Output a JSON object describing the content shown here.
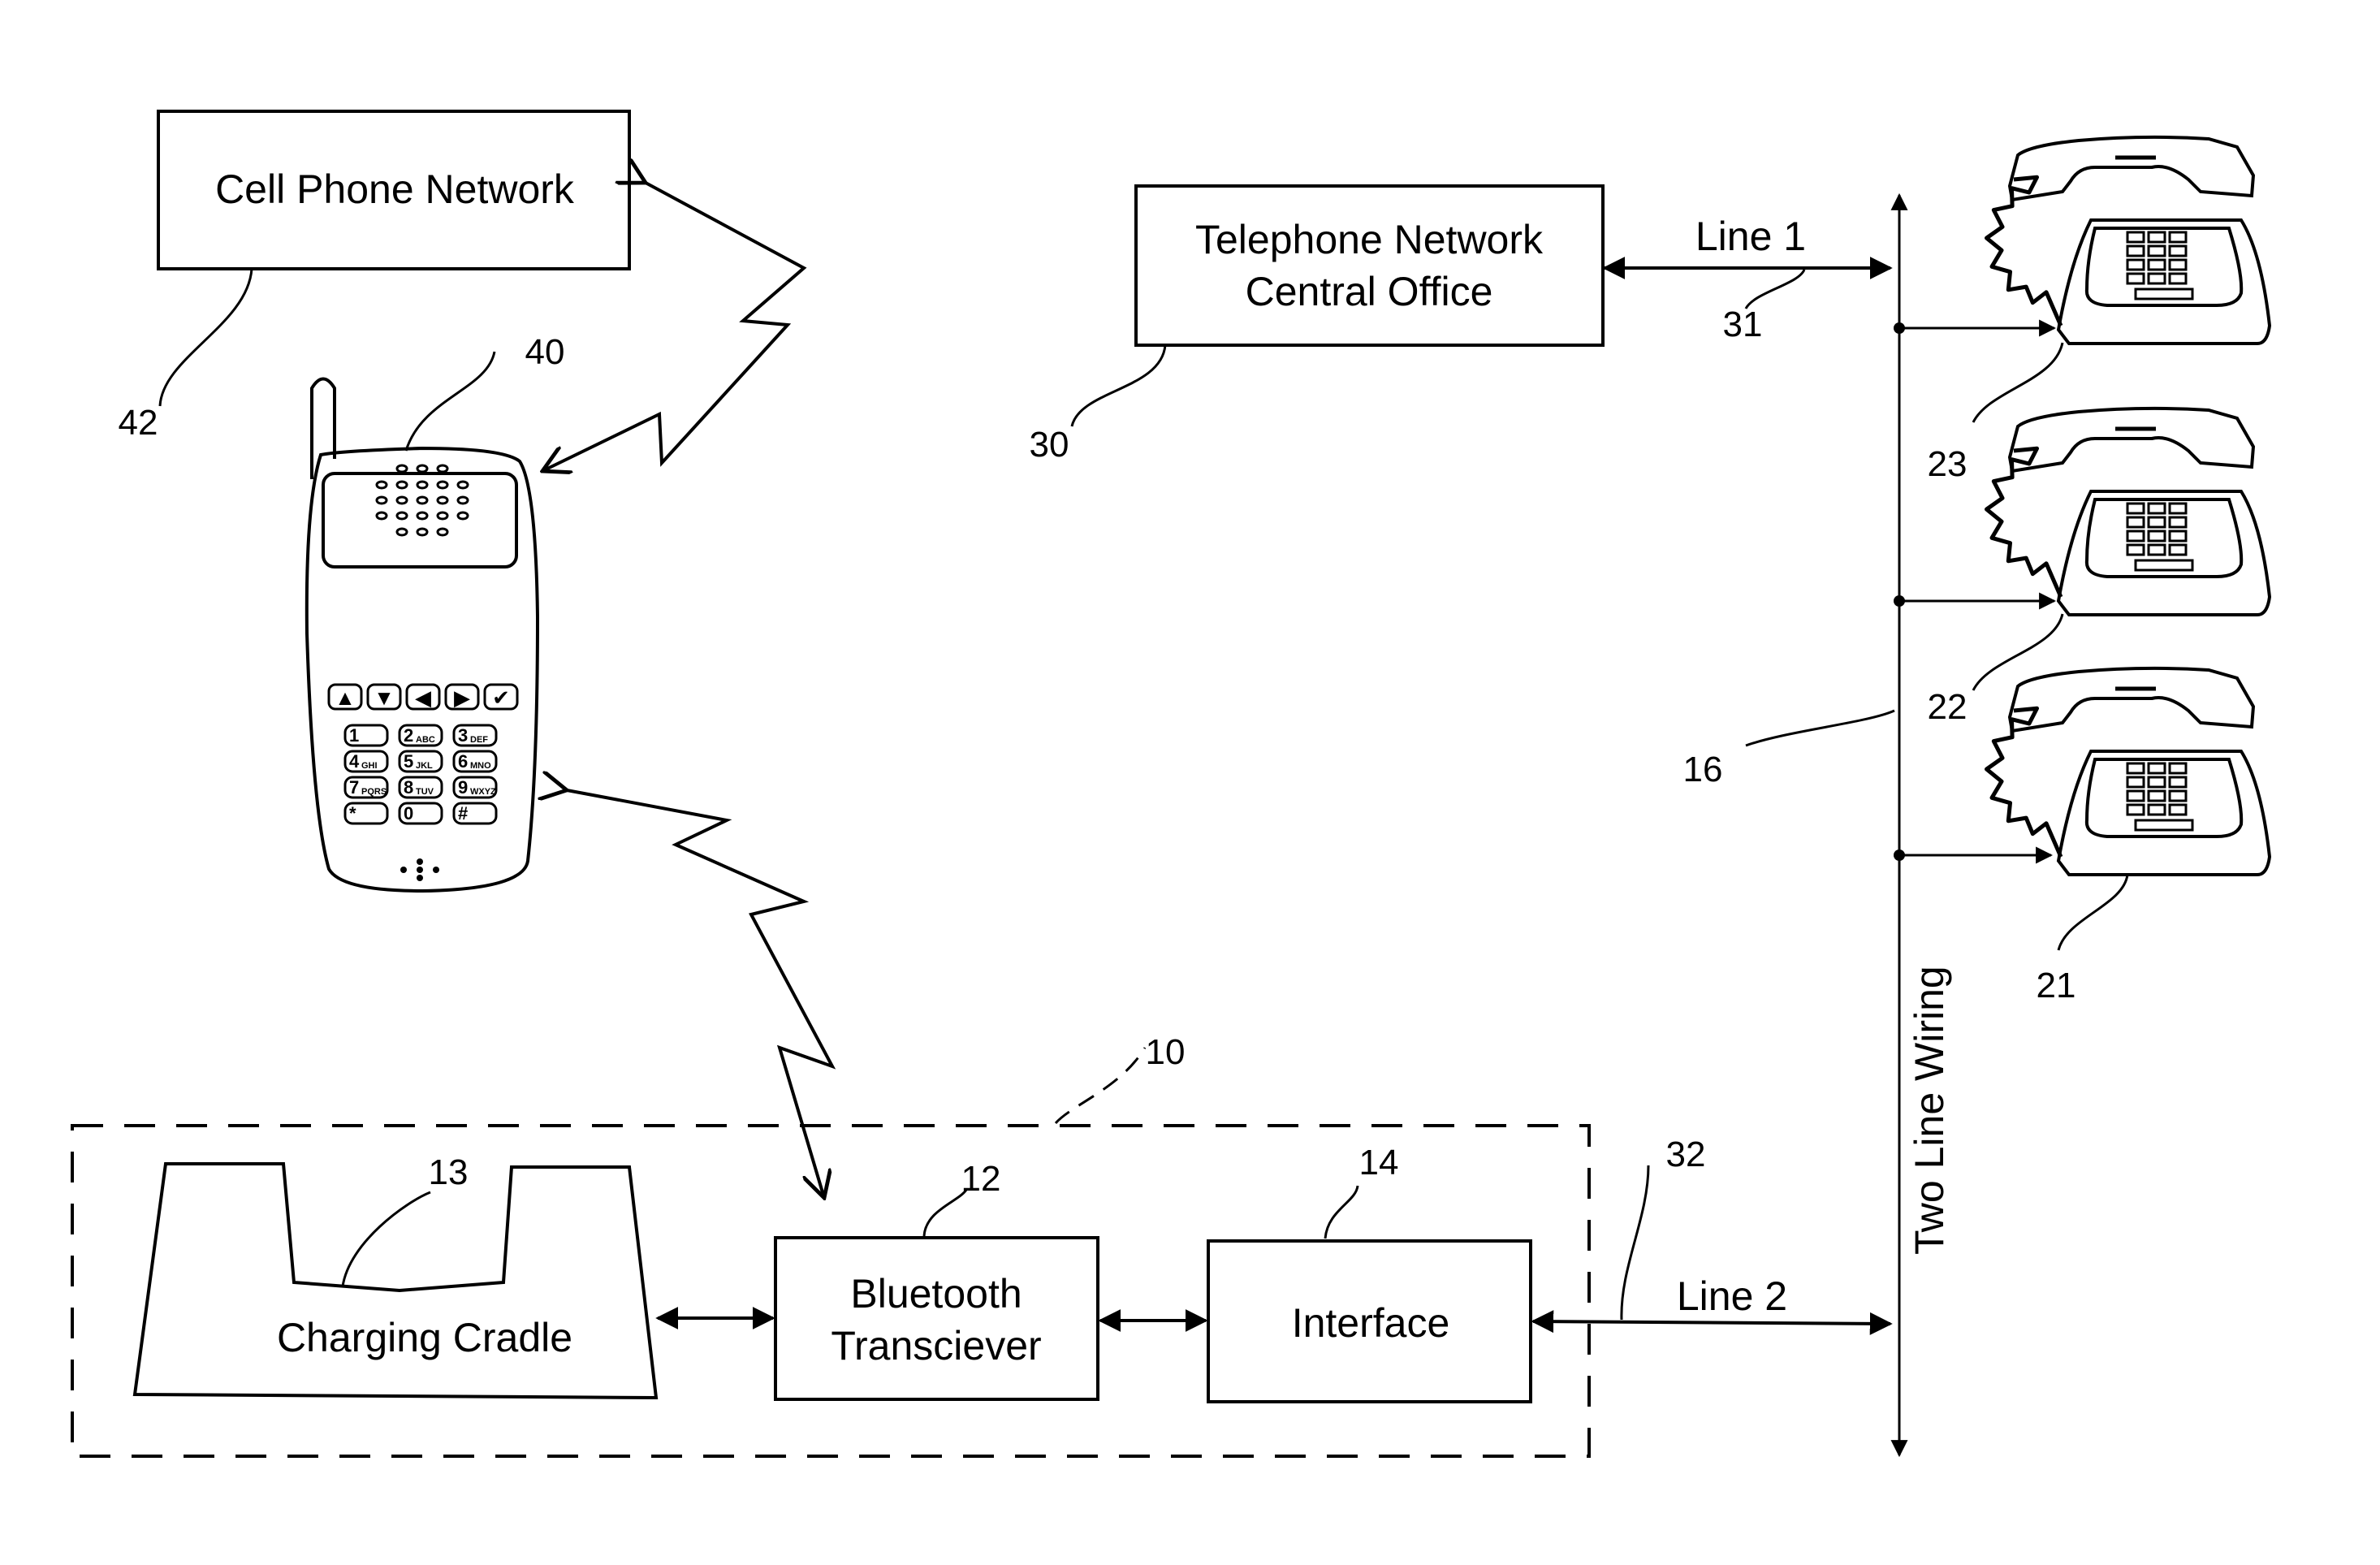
{
  "figure": {
    "blocks": {
      "cell_phone_network": {
        "label": "Cell Phone Network",
        "ref": "42"
      },
      "telephone_network": {
        "line1": "Telephone Network",
        "line2": "Central Office",
        "ref": "30"
      },
      "charging_cradle": {
        "label": "Charging Cradle",
        "ref": "13"
      },
      "bluetooth": {
        "line1": "Bluetooth",
        "line2": "Transciever",
        "ref": "12"
      },
      "interface": {
        "label": "Interface",
        "ref": "14"
      },
      "device_group": {
        "ref": "10"
      }
    },
    "cell_phone": {
      "ref": "40",
      "nav_keys": [
        "▲",
        "▼",
        "◀",
        "▶",
        "✔"
      ],
      "keypad": [
        {
          "digit": "1",
          "letters": ""
        },
        {
          "digit": "2",
          "letters": "ABC"
        },
        {
          "digit": "3",
          "letters": "DEF"
        },
        {
          "digit": "4",
          "letters": "GHI"
        },
        {
          "digit": "5",
          "letters": "JKL"
        },
        {
          "digit": "6",
          "letters": "MNO"
        },
        {
          "digit": "7",
          "letters": "PQRS"
        },
        {
          "digit": "8",
          "letters": "TUV"
        },
        {
          "digit": "9",
          "letters": "WXYZ"
        },
        {
          "digit": "*",
          "letters": ""
        },
        {
          "digit": "0",
          "letters": ""
        },
        {
          "digit": "#",
          "letters": ""
        }
      ]
    },
    "lines": {
      "line1": {
        "label": "Line 1",
        "ref": "31"
      },
      "line2": {
        "label": "Line 2",
        "ref": "32"
      },
      "wiring": {
        "label": "Two Line Wiring",
        "ref": "16"
      }
    },
    "telephones": [
      {
        "ref": "23"
      },
      {
        "ref": "22"
      },
      {
        "ref": "21"
      }
    ]
  }
}
